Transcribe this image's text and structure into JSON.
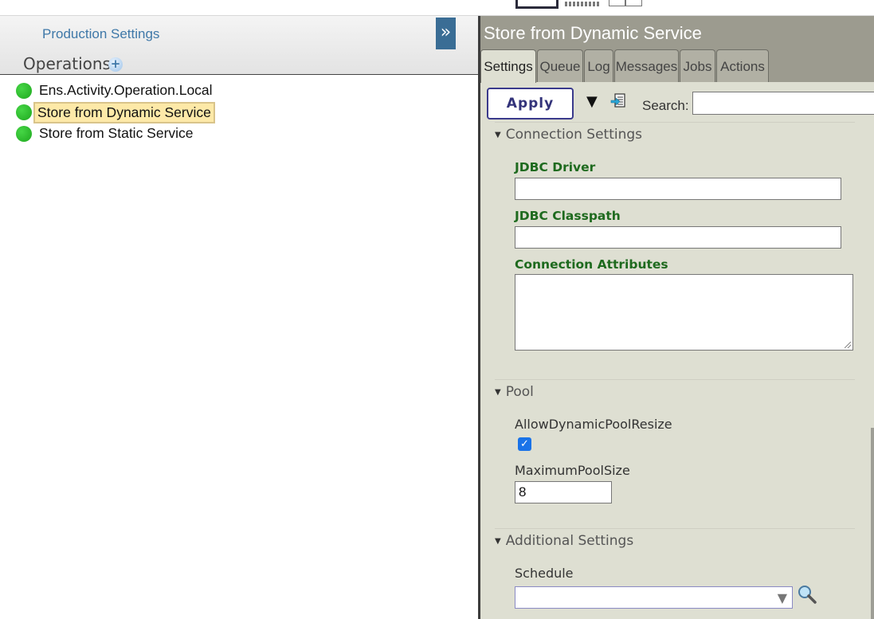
{
  "left_panel": {
    "production_settings_link": "Production Settings",
    "operations_label": "Operations",
    "collapse_button": "»",
    "operations": [
      {
        "label": "Ens.Activity.Operation.Local",
        "status_color": "#22bb22",
        "selected": false
      },
      {
        "label": "Store from Dynamic Service",
        "status_color": "#22bb22",
        "selected": true
      },
      {
        "label": "Store from Static Service",
        "status_color": "#22bb22",
        "selected": false
      }
    ]
  },
  "right_panel": {
    "title": "Store from Dynamic Service",
    "tabs": [
      {
        "label": "Settings",
        "active": true
      },
      {
        "label": "Queue",
        "active": false
      },
      {
        "label": "Log",
        "active": false
      },
      {
        "label": "Messages",
        "active": false
      },
      {
        "label": "Jobs",
        "active": false
      },
      {
        "label": "Actions",
        "active": false
      }
    ],
    "toolbar": {
      "apply_label": "Apply",
      "expand_icon": "triangle-down-icon",
      "export_icon": "export-icon",
      "search_label": "Search:",
      "search_value": ""
    },
    "sections": {
      "connection": {
        "header": "Connection Settings",
        "jdbc_driver_label": "JDBC Driver",
        "jdbc_driver_value": "",
        "jdbc_classpath_label": "JDBC Classpath",
        "jdbc_classpath_value": "",
        "connection_attributes_label": "Connection Attributes",
        "connection_attributes_value": ""
      },
      "pool": {
        "header": "Pool",
        "allow_resize_label": "AllowDynamicPoolResize",
        "allow_resize_checked": true,
        "max_pool_label": "MaximumPoolSize",
        "max_pool_value": "8"
      },
      "additional": {
        "header": "Additional Settings",
        "schedule_label": "Schedule",
        "schedule_value": ""
      }
    }
  },
  "colors": {
    "accent_blue": "#3a6d95",
    "title_bar": "#9c9b8f",
    "panel_bg": "#dedfd2",
    "label_green": "#1e6a1e",
    "selected_bg": "#fde9a8"
  }
}
